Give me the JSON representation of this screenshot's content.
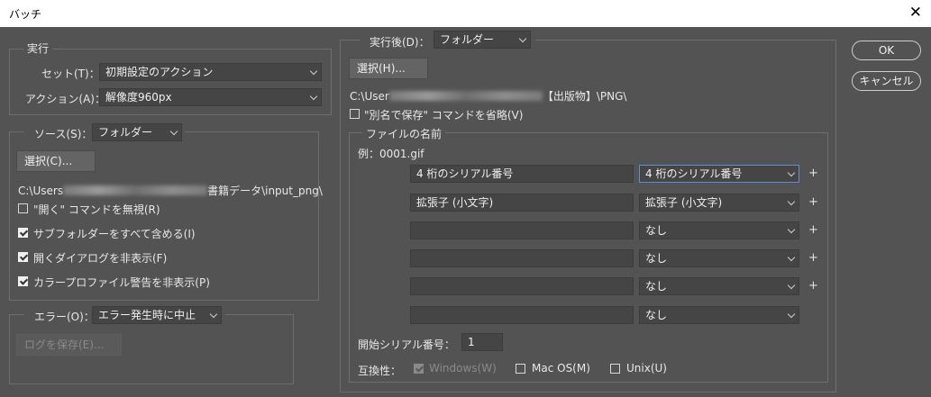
{
  "window": {
    "title": "バッチ",
    "close_glyph": "✕"
  },
  "play": {
    "group_label": "実行",
    "set_label": "セット(T)：",
    "set_value": "初期設定のアクション",
    "action_label": "アクション(A)：",
    "action_value": "解像度960px"
  },
  "source": {
    "label": "ソース(S)：",
    "value": "フォルダー",
    "choose_button": "選択(C)...",
    "path_prefix": "C:\\Users",
    "path_suffix": "書籍データ\\input_png\\",
    "checks": [
      {
        "label": "\"開く\" コマンドを無視(R)",
        "checked": false
      },
      {
        "label": "サブフォルダーをすべて含める(I)",
        "checked": true
      },
      {
        "label": "開くダイアログを非表示(F)",
        "checked": true
      },
      {
        "label": "カラープロファイル警告を非表示(P)",
        "checked": true
      }
    ]
  },
  "errors": {
    "label": "エラー(O)：",
    "value": "エラー発生時に中止",
    "save_log_button": "ログを保存(E)..."
  },
  "destination": {
    "label": "実行後(D)：",
    "value": "フォルダー",
    "choose_button": "選択(H)...",
    "path_prefix": "C:\\User",
    "path_suffix": "【出版物】\\PNG\\",
    "override_label": "\"別名で保存\" コマンドを省略(V)",
    "override_checked": false
  },
  "file_naming": {
    "group_label": "ファイルの名前",
    "example": "例：0001.gif",
    "rows": [
      {
        "field": "4 桁のシリアル番号",
        "select": "4 桁のシリアル番号",
        "plus": "+"
      },
      {
        "field": "拡張子 (小文字)",
        "select": "拡張子 (小文字)",
        "plus": "+"
      },
      {
        "field": "",
        "select": "なし",
        "plus": "+"
      },
      {
        "field": "",
        "select": "なし",
        "plus": "+"
      },
      {
        "field": "",
        "select": "なし",
        "plus": "+"
      },
      {
        "field": "",
        "select": "なし",
        "plus": ""
      }
    ],
    "starting_serial_label": "開始シリアル番号：",
    "starting_serial_value": "1",
    "compat_label": "互換性：",
    "compat": [
      {
        "label": "Windows(W)",
        "checked": true,
        "disabled": true
      },
      {
        "label": "Mac OS(M)",
        "checked": false,
        "disabled": false
      },
      {
        "label": "Unix(U)",
        "checked": false,
        "disabled": false
      }
    ]
  },
  "buttons": {
    "ok": "OK",
    "cancel": "キャンセル"
  }
}
